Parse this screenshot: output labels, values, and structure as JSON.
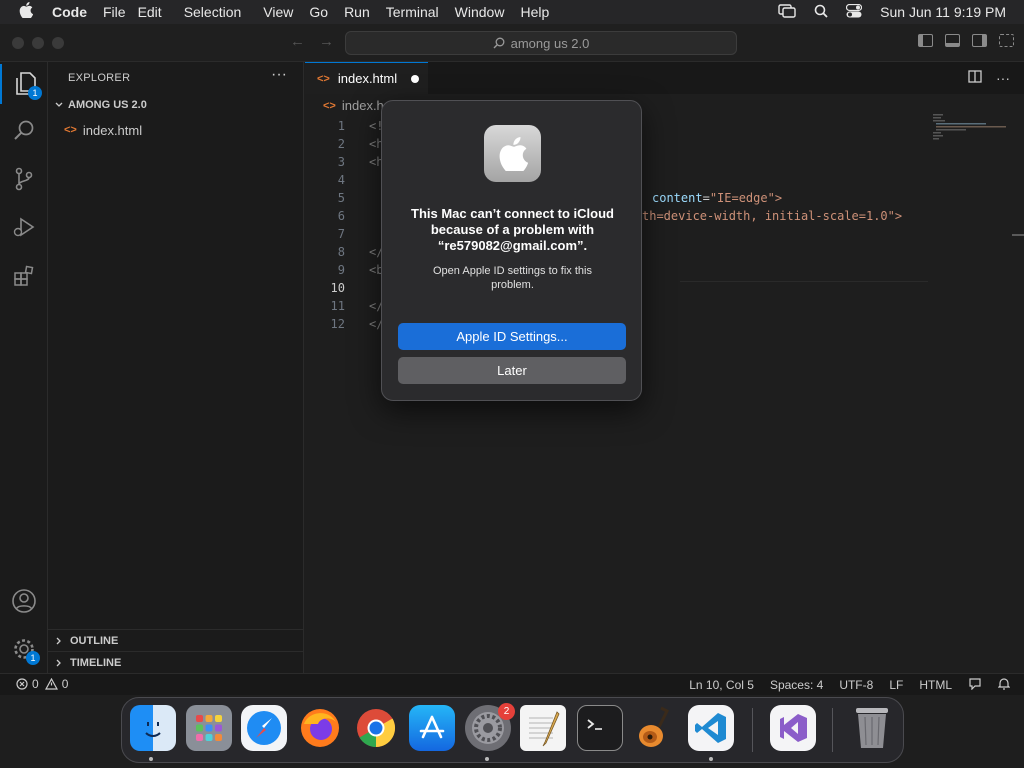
{
  "menubar": {
    "app_name": "Code",
    "items": [
      "File",
      "Edit",
      "Selection",
      "View",
      "Go",
      "Run",
      "Terminal",
      "Window",
      "Help"
    ],
    "clock": "Sun Jun 11  9:19 PM"
  },
  "titlebar": {
    "search_text": "among us 2.0"
  },
  "activity_bar": {
    "explorer_badge": "1",
    "settings_badge": "1"
  },
  "sidebar": {
    "title": "EXPLORER",
    "more": "···",
    "folder": "AMONG US 2.0",
    "files": [
      "index.html"
    ],
    "outline": "OUTLINE",
    "timeline": "TIMELINE"
  },
  "editor": {
    "tab_label": "index.html",
    "breadcrumb": "index.h",
    "line_numbers": [
      "1",
      "2",
      "3",
      "4",
      "5",
      "6",
      "7",
      "8",
      "9",
      "10",
      "11",
      "12"
    ],
    "visible_code": {
      "l1": "<!",
      "l2": "<h",
      "l3": "<h",
      "l5_attr": "content",
      "l5_val": "\"IE=edge\">",
      "l6_tail_a": "th=device-width, initial-scale=1.0\">",
      "l8": "</",
      "l9": "<b",
      "l11": "</",
      "l12": "</"
    }
  },
  "status_bar": {
    "errors": "0",
    "warnings": "0",
    "position": "Ln 10, Col 5",
    "spaces": "Spaces: 4",
    "encoding": "UTF-8",
    "eol": "LF",
    "language": "HTML"
  },
  "dialog": {
    "title": "This Mac can’t connect to iCloud because of a problem with “re579082@gmail.com”.",
    "message": "Open Apple ID settings to fix this problem.",
    "primary_button": "Apple ID Settings...",
    "secondary_button": "Later"
  },
  "dock": {
    "settings_badge": "2",
    "apps": [
      "finder",
      "launchpad",
      "safari",
      "firefox",
      "chrome",
      "app-store",
      "system-settings",
      "textedit",
      "terminal",
      "garageband",
      "vscode",
      "visual-studio",
      "trash"
    ]
  },
  "colors": {
    "accent": "#0078d4",
    "dialog_primary": "#1a6ed8",
    "html_icon": "#e37933"
  }
}
